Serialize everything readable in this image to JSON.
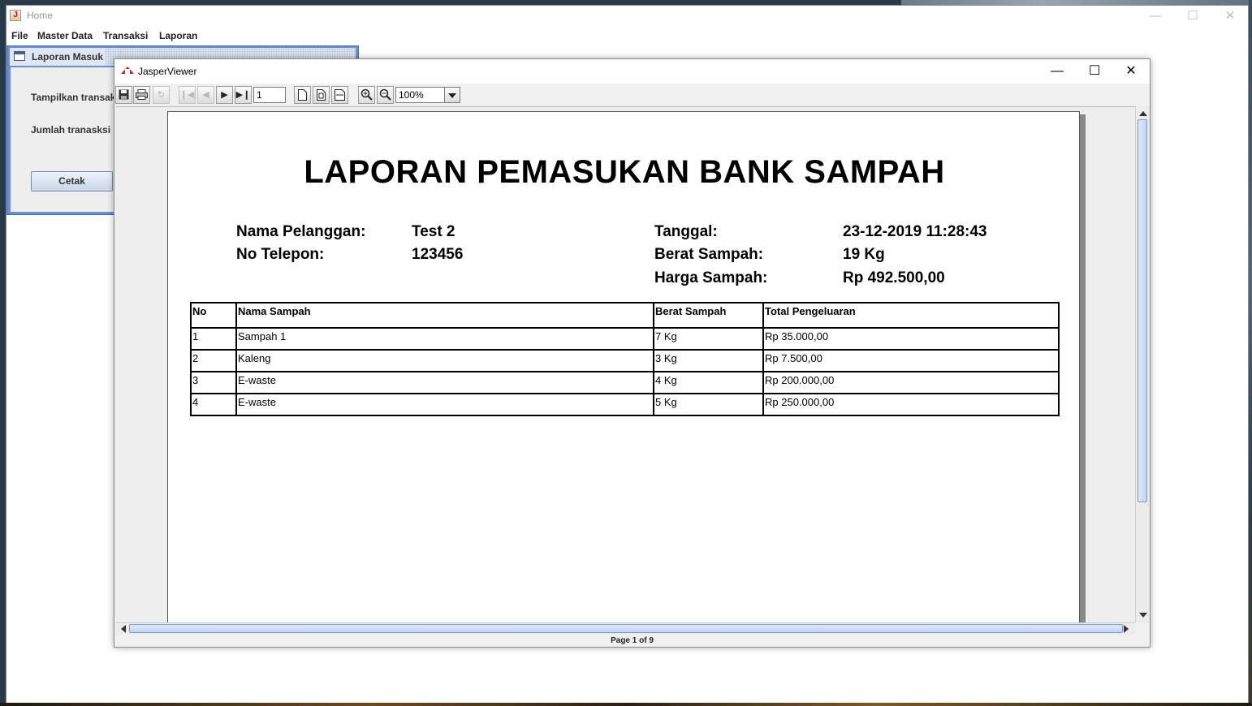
{
  "home": {
    "title": "Home",
    "menu": [
      "File",
      "Master Data",
      "Transaksi",
      "Laporan"
    ]
  },
  "laporan_masuk": {
    "title": "Laporan Masuk",
    "label_tampilkan": "Tampilkan transak",
    "label_jumlah": "Jumlah tranasksi",
    "cetak_label": "Cetak"
  },
  "jasper": {
    "title": "JasperViewer",
    "toolbar": {
      "page_input": "1",
      "zoom_value": "100%",
      "icons": [
        "save-icon",
        "print-icon",
        "reload-icon",
        "first-page-icon",
        "previous-page-icon",
        "next-page-icon",
        "last-page-icon",
        "actual-size-icon",
        "fit-page-icon",
        "fit-width-icon",
        "zoom-in-icon",
        "zoom-out-icon"
      ]
    },
    "status": "Page 1 of 9"
  },
  "report": {
    "title": "LAPORAN PEMASUKAN BANK SAMPAH",
    "nama_pelanggan_label": "Nama Pelanggan:",
    "nama_pelanggan": "Test 2",
    "no_telepon_label": "No Telepon:",
    "no_telepon": "123456",
    "tanggal_label": "Tanggal:",
    "tanggal": "23-12-2019 11:28:43",
    "berat_label": "Berat Sampah:",
    "berat": "19 Kg",
    "harga_label": "Harga Sampah:",
    "harga": "Rp 492.500,00",
    "columns": [
      "No",
      "Nama Sampah",
      "Berat Sampah",
      "Total Pengeluaran"
    ],
    "rows": [
      [
        "1",
        "Sampah 1",
        "7 Kg",
        "Rp 35.000,00"
      ],
      [
        "2",
        "Kaleng",
        "3 Kg",
        "Rp 7.500,00"
      ],
      [
        "3",
        "E-waste",
        "4 Kg",
        "Rp 200.000,00"
      ],
      [
        "4",
        "E-waste",
        "5 Kg",
        "Rp 250.000,00"
      ]
    ]
  }
}
